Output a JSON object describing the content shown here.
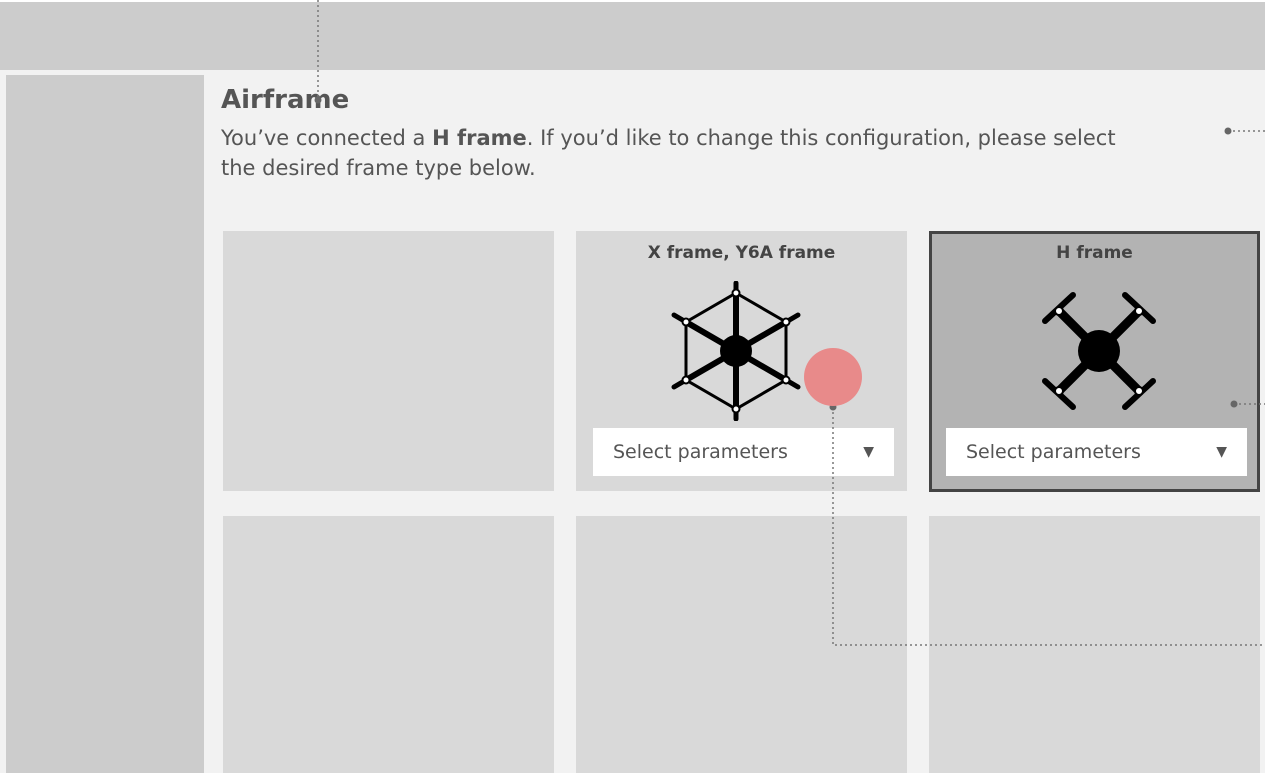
{
  "airframe": {
    "title": "Airframe",
    "desc_prefix": "You’ve connected a ",
    "current_frame": "H frame",
    "desc_suffix": ". If you’d like to change this configuration, please select",
    "desc_line2": "the desired frame type below."
  },
  "cards": [
    {
      "title": ""
    },
    {
      "title": "X frame, Y6A frame",
      "select_label": "Select parameters"
    },
    {
      "title": "H frame",
      "select_label": "Select parameters",
      "selected": true
    },
    {
      "title": ""
    },
    {
      "title": ""
    },
    {
      "title": ""
    }
  ],
  "icons": {
    "hexacopter": "hexacopter-icon",
    "quadcopter": "quadcopter-icon",
    "dropdown": "caret-down-icon"
  },
  "colors": {
    "background": "#f2f2f2",
    "chrome": "#cccccc",
    "card": "#d9d9d9",
    "card_selected": "#b3b3b3",
    "selected_border": "#444444",
    "marker": "#e88a8a",
    "text": "#555555"
  }
}
